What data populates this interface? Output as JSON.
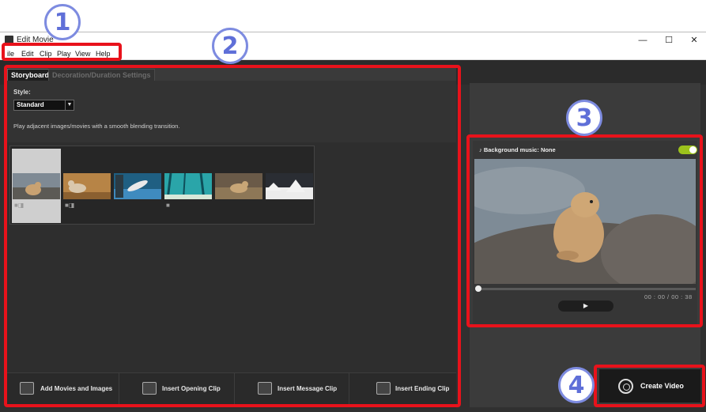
{
  "callouts": [
    "1",
    "2",
    "3",
    "4"
  ],
  "window": {
    "title": "Edit Movie",
    "minimize": "—",
    "maximize": "☐",
    "close": "✕"
  },
  "menu": [
    "ile",
    "Edit",
    "Clip",
    "Play",
    "View",
    "Help"
  ],
  "tabs": {
    "storyboard": "Storyboard",
    "decoration": "Decoration/Duration Settings"
  },
  "style": {
    "label": "Style:",
    "selected": "Standard",
    "description": "Play adjacent images/movies with a smooth blending transition."
  },
  "bottom_buttons": {
    "add": "Add Movies and Images",
    "opening": "Insert Opening Clip",
    "message": "Insert Message Clip",
    "ending": "Insert Ending Clip"
  },
  "preview": {
    "music_label": "Background music: None",
    "time_current": "00 : 00",
    "time_separator": "/",
    "time_total": "00 : 38",
    "play_icon": "▶"
  },
  "create_video": "Create Video",
  "colors": {
    "highlight": "#e8121b",
    "callout": "#7d8be0",
    "toggle_on": "#9cc21c"
  }
}
